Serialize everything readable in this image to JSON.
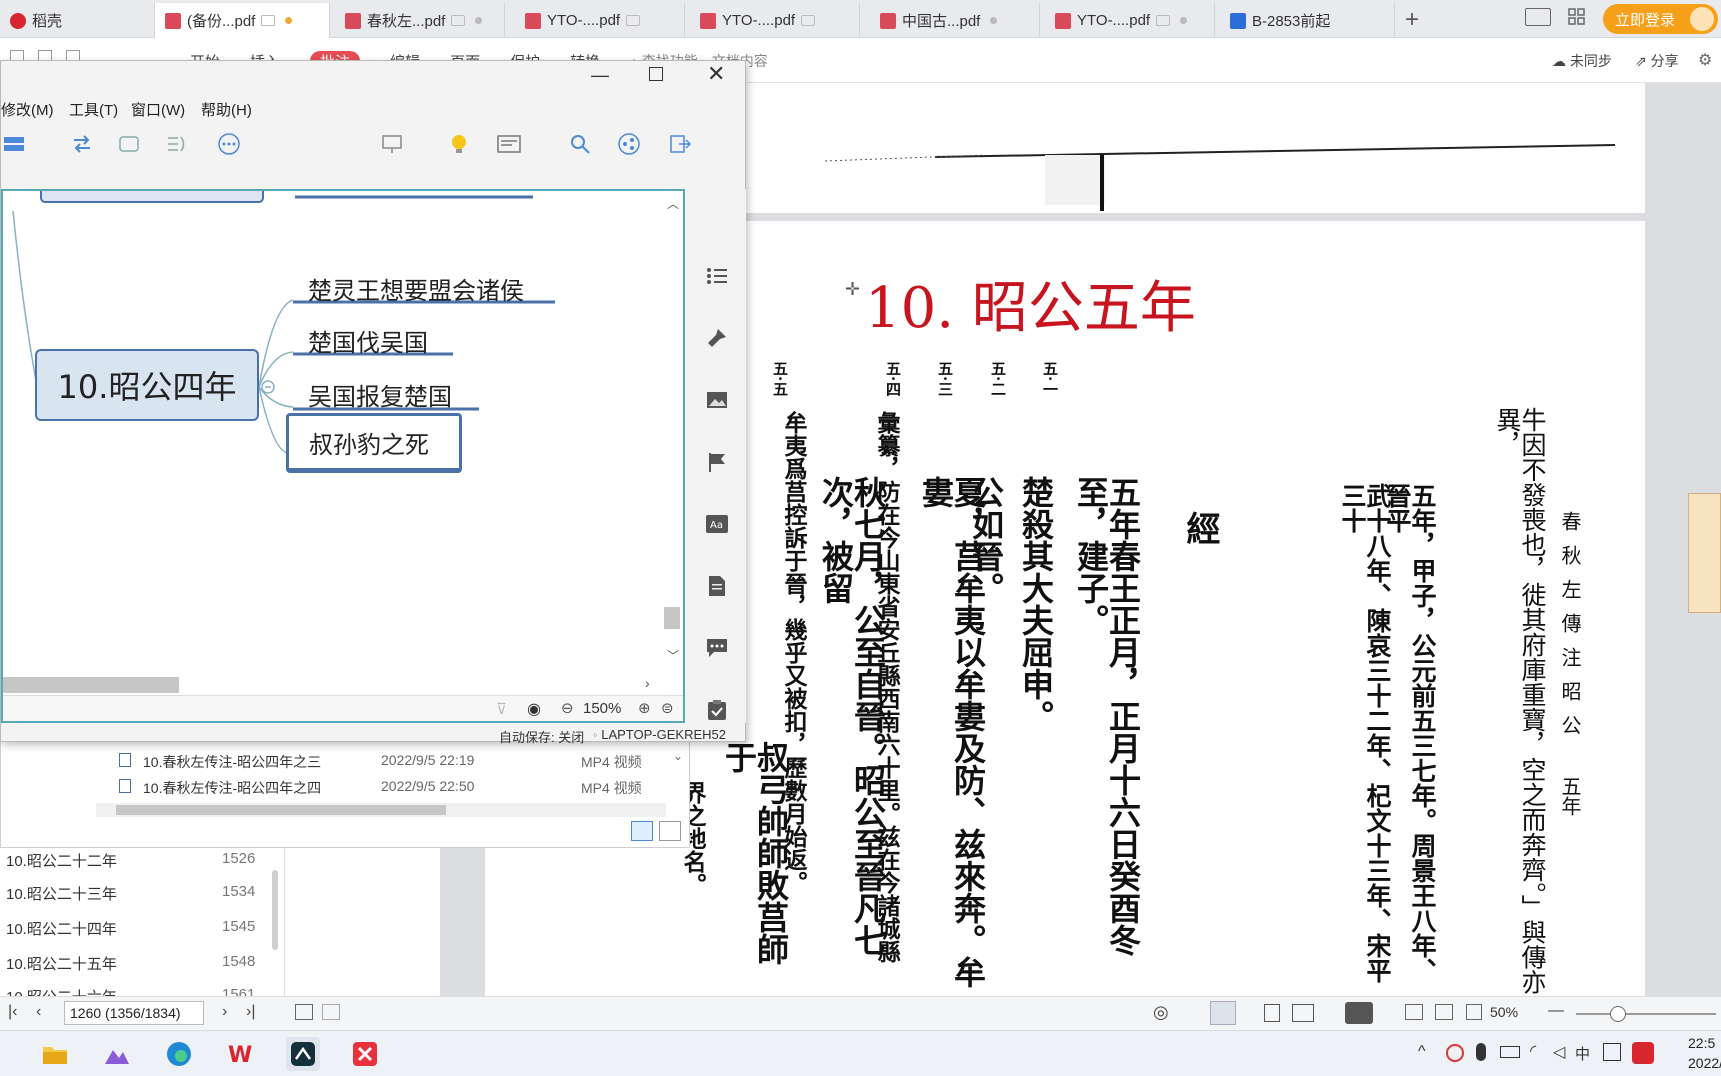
{
  "tabs": [
    {
      "label": "稻壳",
      "color": "#d9262e"
    },
    {
      "label": "(备份...pdf",
      "color": "#d94a5a"
    },
    {
      "label": "春秋左...pdf",
      "color": "#d94a5a"
    },
    {
      "label": "YTO-....pdf",
      "color": "#d94a5a"
    },
    {
      "label": "YTO-....pdf",
      "color": "#d94a5a"
    },
    {
      "label": "中国古...pdf",
      "color": "#d94a5a"
    },
    {
      "label": "YTO-....pdf",
      "color": "#d94a5a"
    },
    {
      "label": "B-2853前起",
      "color": "#2b6fd6"
    }
  ],
  "tabbar": {
    "login": "立即登录"
  },
  "subbar": {
    "items": [
      "开始",
      "插入",
      "批注",
      "编辑",
      "页面",
      "保护",
      "转换"
    ],
    "search": "查找功能、文档内容",
    "sync": "未同步",
    "share": "分享"
  },
  "mindmap": {
    "menus": [
      "修改(M)",
      "工具(T)",
      "窗口(W)",
      "帮助(H)"
    ],
    "central": "10.昭公四年",
    "branches": [
      "楚灵王想要盟会诸侯",
      "楚国伐吴国",
      "吴国报复楚国",
      "叔孙豹之死"
    ],
    "zoom": "150%",
    "autosave": "自动保存: 关闭",
    "computer": "LAPTOP-GEKREH52"
  },
  "explorer": {
    "files": [
      {
        "name": "10.春秋左传注-昭公四年之三",
        "date": "2022/9/5 22:19",
        "type": "MP4 视频"
      },
      {
        "name": "10.春秋左传注-昭公四年之四",
        "date": "2022/9/5 22:50",
        "type": "MP4 视频"
      }
    ]
  },
  "chapters": [
    {
      "name": "10.昭公二十二年",
      "page": "1526"
    },
    {
      "name": "10.昭公二十三年",
      "page": "1534"
    },
    {
      "name": "10.昭公二十四年",
      "page": "1545"
    },
    {
      "name": "10.昭公二十五年",
      "page": "1548"
    },
    {
      "name": "10.昭公二十六年",
      "page": "1561"
    }
  ],
  "pdf": {
    "heading": "10. 昭公五年",
    "header_cols": [
      "春秋左傳注",
      "昭公",
      "五年"
    ],
    "nums": [
      "五·一",
      "五·二",
      "五·三",
      "五·四",
      "五·五"
    ],
    "cols": [
      "牛因不發喪也，徙其府庫重寶，空之而奔齊。」與傳亦異，",
      "五年，甲子，公元前五三七年。周景王八年、晉平",
      "武十八年、陳哀三十二年、杞文十三年、宋平三十",
      "經",
      "五年春王正月，正月十六日癸酉冬至，建子。",
      "楚殺其大夫屈申。",
      "公如晉。",
      "夏，莒牟夷以牟婁及防、兹來奔。牟婁",
      "彙纂，防在今山東省安丘縣西南六十里。兹在今諸城縣",
      "秋七月，公至自晉。昭公至晉凡七次，被留",
      "牟夷爲莒控訴于晉，幾乎又被扣，歷數月始返。",
      "叔弓帥師敗莒師于",
      "界之地名。"
    ]
  },
  "status": {
    "page": "1260 (1356/1834)",
    "zoom": "50%"
  },
  "taskbar": {
    "time": "22:5",
    "date": "2022/"
  },
  "colors": {
    "accent": "#c8141e",
    "canvas_border": "#58a9b5",
    "node_fill": "#d8e4f0",
    "node_border": "#4a72a8"
  }
}
